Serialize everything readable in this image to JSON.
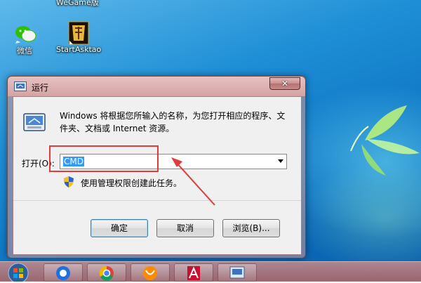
{
  "desktop": {
    "icons": [
      {
        "label": "WeGame版",
        "icon": "wegame-icon"
      },
      {
        "label": "微信",
        "icon": "wechat-icon"
      },
      {
        "label": "StartAsktao",
        "icon": "asktao-game-icon"
      }
    ]
  },
  "run_dialog": {
    "title": "运行",
    "description": "Windows 将根据您所输入的名称，为您打开相应的程序、文件夹、文档或 Internet 资源。",
    "open_label": "打开(O):",
    "input_value": "CMD",
    "admin_note": "使用管理权限创建此任务。",
    "buttons": {
      "ok": "确定",
      "cancel": "取消",
      "browse": "浏览(B)..."
    },
    "close_glyph": "✕"
  },
  "taskbar": {
    "items": [
      "start-orb",
      "qq-browser-icon",
      "chrome-icon",
      "uc-browser-icon",
      "autocad-icon",
      "run-icon"
    ]
  },
  "annotation": {
    "color": "#e23b3b"
  }
}
